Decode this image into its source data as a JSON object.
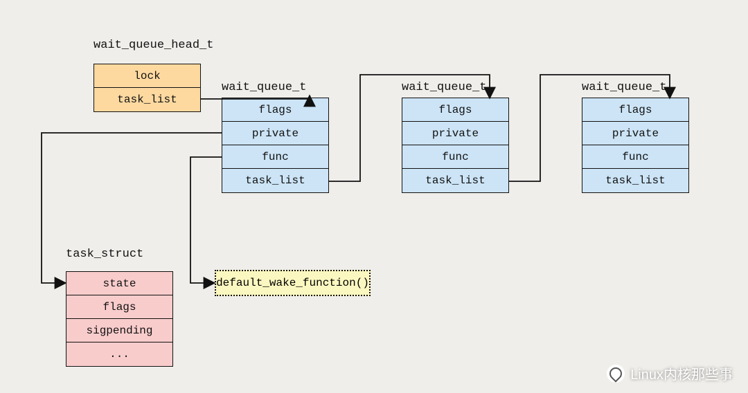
{
  "labels": {
    "head": "wait_queue_head_t",
    "node": "wait_queue_t",
    "task": "task_struct"
  },
  "head_fields": {
    "f0": "lock",
    "f1": "task_list"
  },
  "node_fields": {
    "f0": "flags",
    "f1": "private",
    "f2": "func",
    "f3": "task_list"
  },
  "task_fields": {
    "f0": "state",
    "f1": "flags",
    "f2": "sigpending",
    "f3": "..."
  },
  "func_box": "default_wake_function()",
  "watermark": "Linux内核那些事"
}
